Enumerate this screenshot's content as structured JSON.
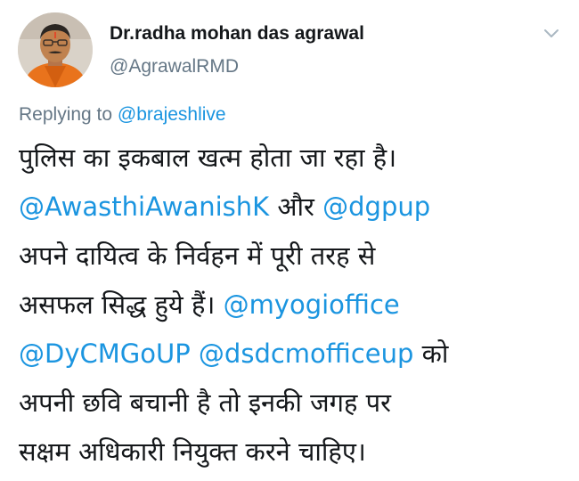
{
  "author": {
    "name": "Dr.radha mohan das agrawal",
    "handle": "@AgrawalRMD"
  },
  "reply": {
    "prefix": "Replying to",
    "to": "@brajeshlive"
  },
  "tweet": {
    "line1": "पुलिस का इकबाल खत्म होता जा रहा है।",
    "mention1": "@AwasthiAwanishK",
    "and": " और ",
    "mention2": "@dgpup",
    "line3": "अपने दायित्व के निर्वहन में पूरी तरह से",
    "line4_text": "असफल सिद्ध हुये हैं। ",
    "mention3": "@myogioffice",
    "mention4": "@DyCMGoUP",
    "space": " ",
    "mention5": "@dsdcmofficeup",
    "line5_tail": " को",
    "line6": "अपनी छवि बचानी है तो इनकी जगह पर",
    "line7": "सक्षम अधिकारी नियुक्त करने चाहिए।"
  },
  "icons": {
    "menu": "chevron-down-icon"
  },
  "colors": {
    "link": "#1b95e0",
    "secondary": "#657786",
    "text": "#14171a"
  }
}
